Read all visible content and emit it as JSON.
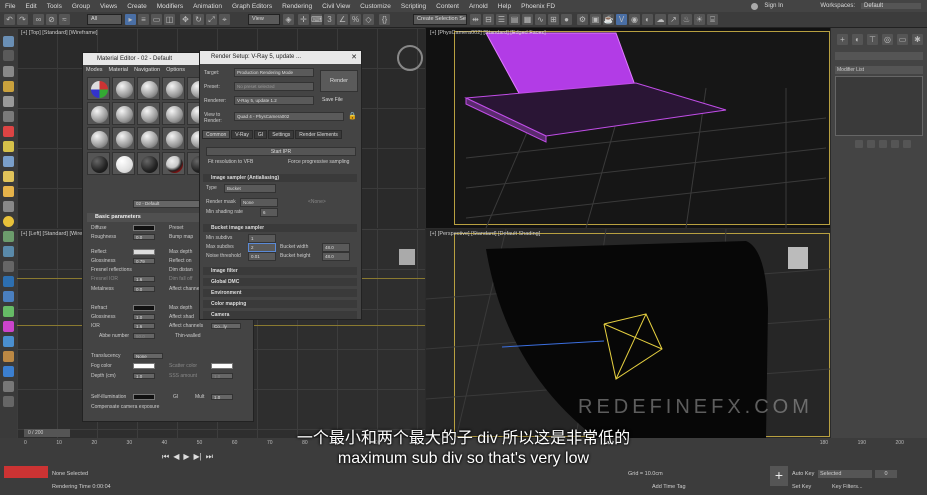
{
  "menubar": {
    "items": [
      "File",
      "Edit",
      "Tools",
      "Group",
      "Views",
      "Create",
      "Modifiers",
      "Animation",
      "Graph Editors",
      "Rendering",
      "Civil View",
      "Customize",
      "Scripting",
      "Content",
      "Arnold",
      "Help",
      "Phoenix FD"
    ],
    "signin": "Sign In",
    "workspaces_label": "Workspaces:",
    "workspaces_value": "Default"
  },
  "toolbar": {
    "filter": "All",
    "view": "View",
    "selection_set": "Create Selection Se"
  },
  "viewports": {
    "top_left": "[+] [Top] [Standard] [Wireframe]",
    "left": "[+] [Left] [Standard] [Wireframe]",
    "camera": "[+] [PhysCamera002] [Standard] [Edged Faces]",
    "perspective": "[+] [Perspective] [Standard] [Default Shading]"
  },
  "material_editor": {
    "title": "Material Editor - 02 - Default",
    "menu": [
      "Modes",
      "Material",
      "Navigation",
      "Options"
    ],
    "material_name": "02 - Default",
    "basic_params": "Basic parameters",
    "labels": {
      "diffuse": "Diffuse",
      "roughness": "Roughness",
      "roughness_val": "0.0",
      "preset": "Preset",
      "bump_map": "Bump map",
      "reflect": "Reflect",
      "max_depth": "Max depth",
      "glossiness": "Glossiness",
      "glossiness_val": "0.79",
      "reflect_on": "Reflect on",
      "fresnel": "Fresnel reflections",
      "dim_distance": "Dim distan",
      "fresnel_ior": "Fresnel IOR",
      "fresnel_ior_val": "1.6",
      "dim_falloff": "Dim fall off",
      "metalness": "Metalness",
      "metalness_val": "0.0",
      "affect_channels": "Affect channe",
      "refract": "Refract",
      "refract_max_depth": "Max depth",
      "refr_gloss": "Glossiness",
      "refr_gloss_val": "1.0",
      "affect_shadows": "Affect shad",
      "ior": "IOR",
      "ior_val": "1.6",
      "affect_ch2": "Affect channels",
      "co_ly": "Co...ly",
      "abbe": "Abbe number",
      "abbe_val": "50.0",
      "thin_walled": "Thin-walled",
      "translucency": "Translucency",
      "transl_val": "None",
      "fog_color": "Fog color",
      "scatter_color": "Scatter color",
      "depth": "Depth (cm)",
      "depth_val": "1.0",
      "sss_amount": "SSS amount",
      "sss_val": "1.0",
      "self_illum": "Self-illumination",
      "gi": "GI",
      "mult": "Mult",
      "mult_val": "1.0",
      "compensate": "Compensate camera exposure"
    }
  },
  "render_setup": {
    "title": "Render Setup: V-Ray 5, update ...",
    "target_label": "Target:",
    "target_value": "Production Rendering Mode",
    "preset_label": "Preset:",
    "preset_value": "No preset selected",
    "renderer_label": "Renderer:",
    "renderer_value": "V-Ray 5, update 1.2",
    "save_file": "Save File",
    "view_label": "View to Render:",
    "view_value": "Quad 4 - PhysCamera002",
    "render_button": "Render",
    "tabs": [
      "Common",
      "V-Ray",
      "GI",
      "Settings",
      "Render Elements"
    ],
    "start_ipr": "Start IPR",
    "fit_resolution": "Fit resolution to VFB",
    "force_progressive": "Force progressive sampling",
    "image_sampler": "Image sampler (Antialiasing)",
    "type_label": "Type",
    "type_value": "Bucket",
    "render_mask_label": "Render mask",
    "render_mask_value": "None",
    "render_mask_none": "<None>",
    "min_shading_label": "Min shading rate",
    "min_shading_value": "6",
    "bucket_sampler": "Bucket image sampler",
    "min_subdivs": "Min subdivs",
    "min_subdivs_val": "1",
    "max_subdivs": "Max subdivs",
    "max_subdivs_val": "2",
    "bucket_width": "Bucket width",
    "bucket_width_val": "48.0",
    "noise_threshold": "Noise threshold",
    "noise_threshold_val": "0.01",
    "bucket_height": "Bucket height",
    "bucket_height_val": "48.0",
    "image_filter": "Image filter",
    "global_dmc": "Global DMC",
    "environment": "Environment",
    "color_mapping": "Color mapping",
    "camera": "Camera"
  },
  "right_panel": {
    "modifier_list": "Modifier List"
  },
  "bottom": {
    "frame": "0 / 200",
    "ticks": [
      "0",
      "10",
      "20",
      "30",
      "40",
      "50",
      "60",
      "70",
      "80",
      "90",
      "100"
    ],
    "right_ticks": [
      "180",
      "190",
      "200"
    ],
    "none_selected": "None Selected",
    "render_time": "Rendering Time 0:00:04",
    "grid": "Grid = 10.0cm",
    "add_time_tag": "Add Time Tag",
    "auto_key": "Auto Key",
    "selected": "Selected",
    "set_key": "Set Key",
    "key_filters": "Key Filters...",
    "frame_no": "0"
  },
  "subtitles": {
    "chinese": "一个最小和两个最大的子 div 所以这是非常低的",
    "english": "maximum sub div so that's very low"
  },
  "watermark": "REDEFINEFX.COM"
}
